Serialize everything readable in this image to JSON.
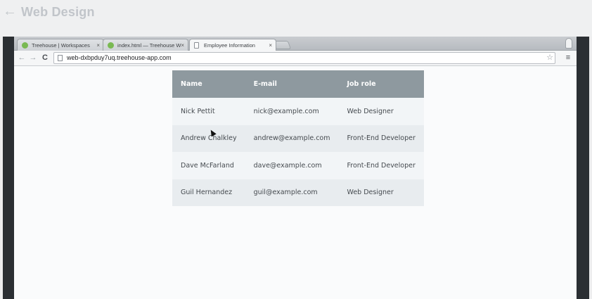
{
  "course": {
    "back_icon": "arrow-left-icon",
    "title": "Web Design"
  },
  "browser": {
    "tabs": [
      {
        "label": "Treehouse | Workspaces",
        "icon": "treehouse-favicon",
        "close": "×"
      },
      {
        "label": "index.html — Treehouse W",
        "icon": "treehouse-favicon",
        "close": "×"
      },
      {
        "label": "Employee Information",
        "icon": "page-icon",
        "close": "×"
      }
    ],
    "url": "web-dxbpduy7uq.treehouse-app.com",
    "nav": {
      "back": "←",
      "forward": "→",
      "reload": "C",
      "menu": "≡",
      "star": "☆"
    }
  },
  "table": {
    "headers": [
      "Name",
      "E-mail",
      "Job role"
    ],
    "rows": [
      [
        "Nick Pettit",
        "nick@example.com",
        "Web Designer"
      ],
      [
        "Andrew Chalkley",
        "andrew@example.com",
        "Front-End Developer"
      ],
      [
        "Dave McFarland",
        "dave@example.com",
        "Front-End Developer"
      ],
      [
        "Guil Hernandez",
        "guil@example.com",
        "Web Designer"
      ]
    ]
  },
  "colors": {
    "header_bg": "#8e999f",
    "row_light": "#f2f5f7",
    "row_dark": "#e8ecef",
    "favicon_green": "#79b952"
  }
}
